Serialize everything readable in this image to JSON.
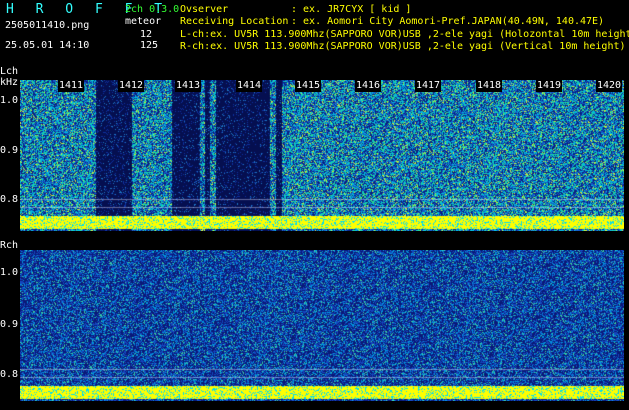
{
  "header": {
    "app_title": "H R O F F T",
    "mode": "2ch 0.3.0",
    "filename": "2505011410.png",
    "type_label": "meteor",
    "timestamp": "25.05.01 14:10",
    "count1": "12",
    "count2": "125",
    "observer_label": "Ovserver",
    "observer_value": ": ex. JR7CYX [ kid ]",
    "location_label": "Receiving Location",
    "location_value": ": ex. Aomori City Aomori-Pref.JAPAN(40.49N, 140.47E)",
    "lch_line": "L-ch:ex. UV5R 113.900Mhz(SAPPORO VOR)USB ,2-ele yagi (Holozontal 10m height",
    "rch_line": "R-ch:ex. UV5R 113.900Mhz(SAPPORO VOR)USB ,2-ele yagi (Vertical 10m height)"
  },
  "lch": {
    "label": "Lch",
    "unit": "kHz",
    "y_ticks": [
      "1.0",
      "0.9",
      "0.8"
    ]
  },
  "rch": {
    "label": "Rch",
    "y_ticks": [
      "1.0",
      "0.9",
      "0.8"
    ]
  },
  "time_ticks": [
    "1411",
    "1412",
    "1413",
    "1414",
    "1415",
    "1416",
    "1417",
    "1418",
    "1419",
    "1420"
  ],
  "colors": {
    "bg": "#000000",
    "cyan": "#33ffff",
    "green": "#33ff33",
    "yellow": "#ffff00",
    "deep_blue": "#0a1a7a",
    "navy": "#04104a"
  }
}
